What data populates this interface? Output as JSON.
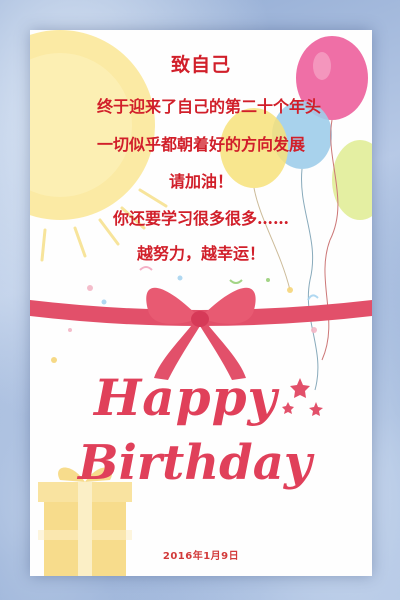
{
  "card": {
    "title": "致自己",
    "lines": [
      "终于迎来了自己的第二十个年头",
      "一切似乎都朝着好的方向发展",
      "请加油！",
      "你还要学习很多很多……",
      "越努力，越幸运！"
    ],
    "greeting_word1": "Happy",
    "greeting_word2": "Birthday",
    "date": "2016年1月9日"
  },
  "colors": {
    "text_red": "#d11f2a",
    "ribbon": "#e2506a",
    "sun": "#fbe89a",
    "balloon_pink": "#ef6fa6",
    "balloon_blue": "#9fcdea",
    "balloon_yellow": "#f7e27a",
    "gift": "#f7dc8c"
  },
  "icons": [
    "sun-icon",
    "balloon-icon",
    "ribbon-bow-icon",
    "gift-box-icon",
    "star-icon"
  ]
}
